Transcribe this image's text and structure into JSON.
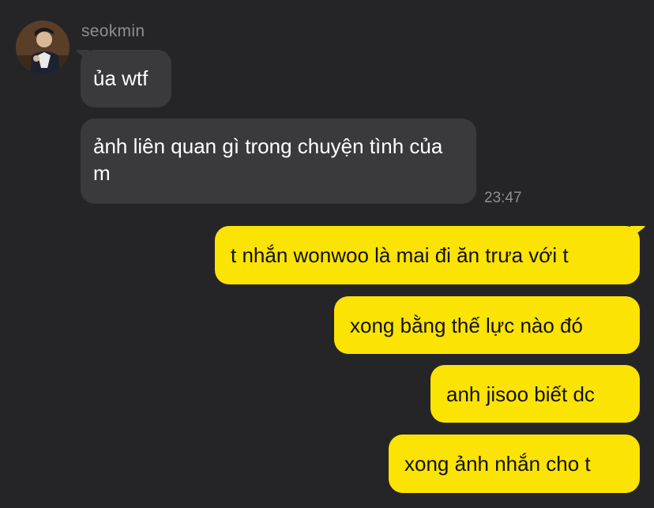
{
  "chat": {
    "sender_name": "seokmin",
    "incoming": [
      {
        "text": "ủa wtf"
      },
      {
        "text": "ảnh liên quan gì trong chuyện tình của m"
      }
    ],
    "incoming_time": "23:47",
    "outgoing": [
      {
        "text": "t nhắn wonwoo là mai đi ăn trưa với t"
      },
      {
        "text": "xong bằng thế lực nào đó"
      },
      {
        "text": "anh jisoo biết dc"
      },
      {
        "text": "xong ảnh nhắn cho t"
      }
    ]
  },
  "colors": {
    "background": "#252527",
    "incoming_bubble": "#3a3a3c",
    "outgoing_bubble": "#fbe303",
    "meta_text": "#8e8e93"
  },
  "icons": {
    "avatar": "profile-photo"
  }
}
